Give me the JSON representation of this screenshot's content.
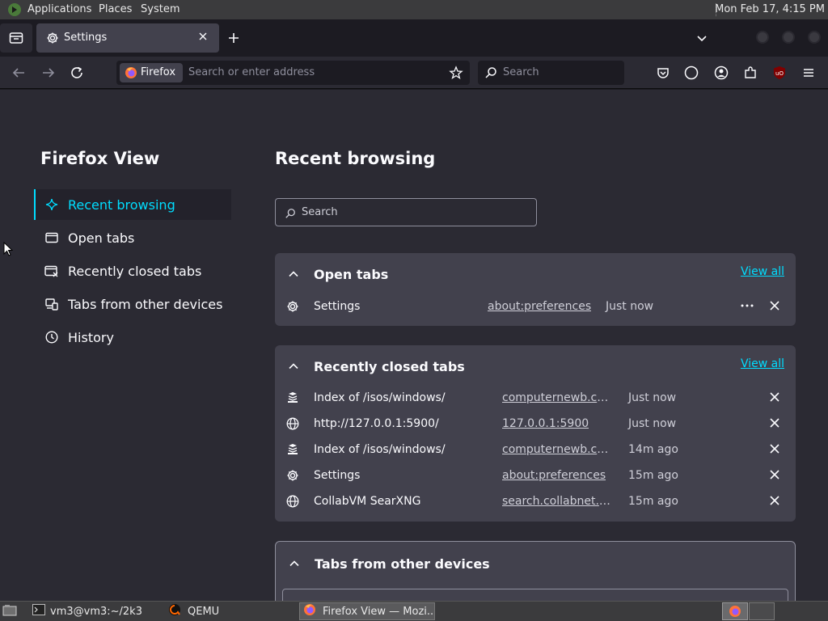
{
  "top_panel": {
    "menus": [
      "Applications",
      "Places",
      "System"
    ],
    "clock": "Mon Feb 17,  4:15 PM"
  },
  "tabstrip": {
    "active_tab_title": "Settings"
  },
  "navbar": {
    "identity_label": "Firefox",
    "url_placeholder": "Search or enter address",
    "search_placeholder": "Search"
  },
  "sidebar": {
    "heading": "Firefox View",
    "items": [
      {
        "label": "Recent browsing",
        "icon": "sparkle-icon",
        "selected": true
      },
      {
        "label": "Open tabs",
        "icon": "window-icon"
      },
      {
        "label": "Recently closed tabs",
        "icon": "closed-tabs-icon"
      },
      {
        "label": "Tabs from other devices",
        "icon": "devices-icon"
      },
      {
        "label": "History",
        "icon": "clock-icon"
      }
    ]
  },
  "main": {
    "heading": "Recent browsing",
    "search_placeholder": "Search",
    "open_tabs": {
      "title": "Open tabs",
      "view_all": "View all",
      "rows": [
        {
          "icon": "gear-icon",
          "title": "Settings",
          "url": "about:preferences",
          "time": "Just now"
        }
      ]
    },
    "recently_closed": {
      "title": "Recently closed tabs",
      "view_all": "View all",
      "rows": [
        {
          "icon": "stack-favicon-icon",
          "title": "Index of /isos/windows/",
          "url": "computernewb.com",
          "time": "Just now"
        },
        {
          "icon": "globe-icon",
          "title": "http://127.0.0.1:5900/",
          "url": "127.0.0.1:5900",
          "time": "Just now"
        },
        {
          "icon": "stack-favicon-icon",
          "title": "Index of /isos/windows/",
          "url": "computernewb.com",
          "time": "14m ago"
        },
        {
          "icon": "gear-icon",
          "title": "Settings",
          "url": "about:preferences",
          "time": "15m ago"
        },
        {
          "icon": "globe-icon",
          "title": "CollabVM SearXNG",
          "url": "search.collabnet.l...",
          "time": "15m ago"
        }
      ]
    },
    "other_devices": {
      "title": "Tabs from other devices"
    }
  },
  "taskbar": {
    "tasks": [
      "vm3@vm3:~/2k3",
      "QEMU",
      "Firefox View — Mozi..."
    ]
  },
  "colors": {
    "accent": "#00ddff",
    "content_bg": "#2b2a33",
    "card_bg": "#42414d"
  }
}
